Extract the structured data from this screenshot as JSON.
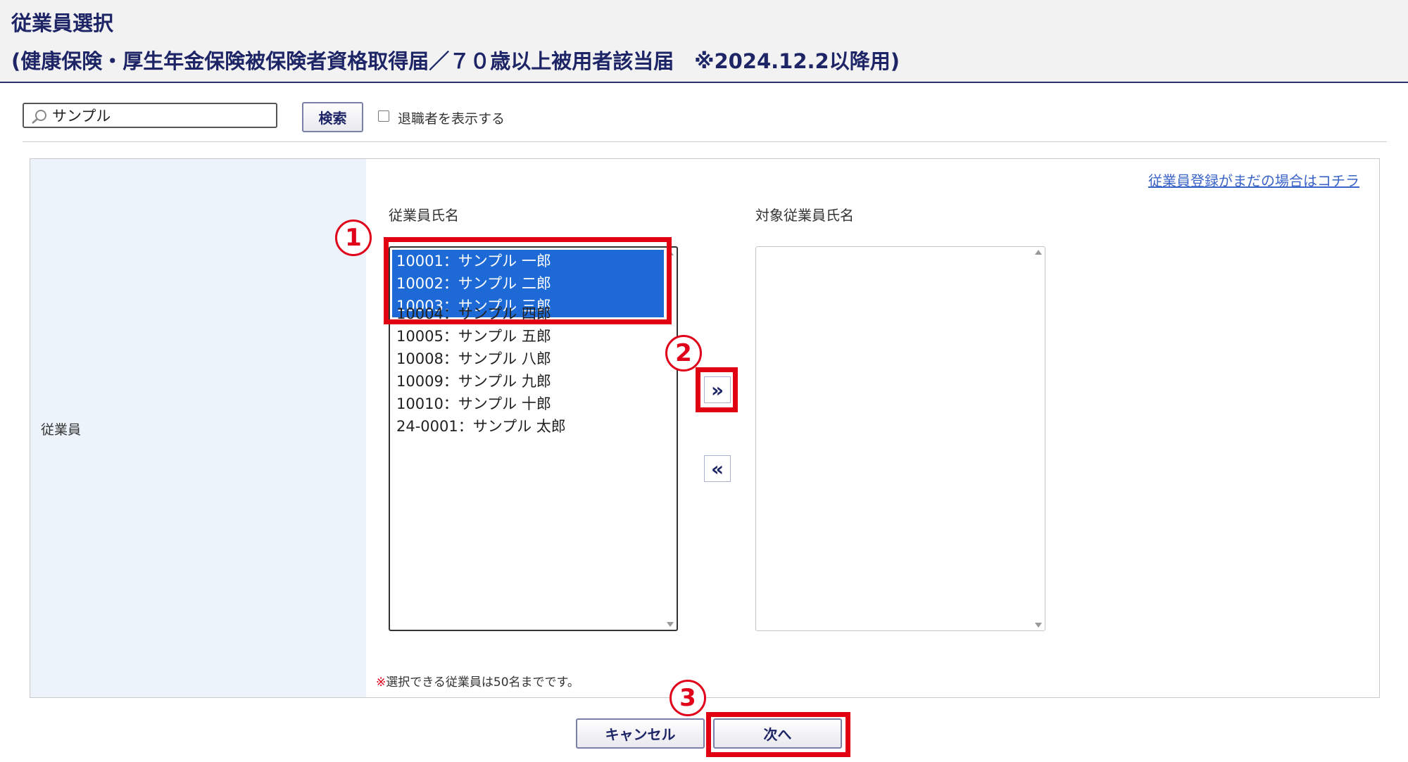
{
  "header": {
    "title": "従業員選択",
    "subtitle": "(健康保険・厚生年金保険被保険者資格取得届／７０歳以上被用者該当届　※2024.12.2以降用)"
  },
  "search": {
    "value": "サンプル",
    "button_label": "検索",
    "retired_checkbox_label": "退職者を表示する",
    "retired_checked": false
  },
  "form": {
    "row_label": "従業員",
    "register_link": "従業員登録がまだの場合はコチラ",
    "left_list_header": "従業員氏名",
    "right_list_header": "対象従業員氏名",
    "employees": [
      {
        "label": "10001：サンプル 一郎",
        "selected": true
      },
      {
        "label": "10002：サンプル 二郎",
        "selected": true
      },
      {
        "label": "10003：サンプル 三郎",
        "selected": true
      },
      {
        "label": "10004：サンプル 四郎",
        "selected": false
      },
      {
        "label": "10005：サンプル 五郎",
        "selected": false
      },
      {
        "label": "10008：サンプル 八郎",
        "selected": false
      },
      {
        "label": "10009：サンプル 九郎",
        "selected": false
      },
      {
        "label": "10010：サンプル 十郎",
        "selected": false
      },
      {
        "label": "24-0001：サンプル 太郎",
        "selected": false
      }
    ],
    "target_employees": [],
    "move_right_label": "»",
    "move_left_label": "«",
    "note_mark": "※",
    "note_text": "選択できる従業員は50名までです。"
  },
  "footer": {
    "cancel_label": "キャンセル",
    "next_label": "次へ"
  },
  "annotations": {
    "marker1": "1",
    "marker2": "2",
    "marker3": "3"
  },
  "colors": {
    "accent": "#1e2566",
    "selection": "#1d6ad6",
    "highlight": "#e00012",
    "link": "#3a64c7"
  }
}
